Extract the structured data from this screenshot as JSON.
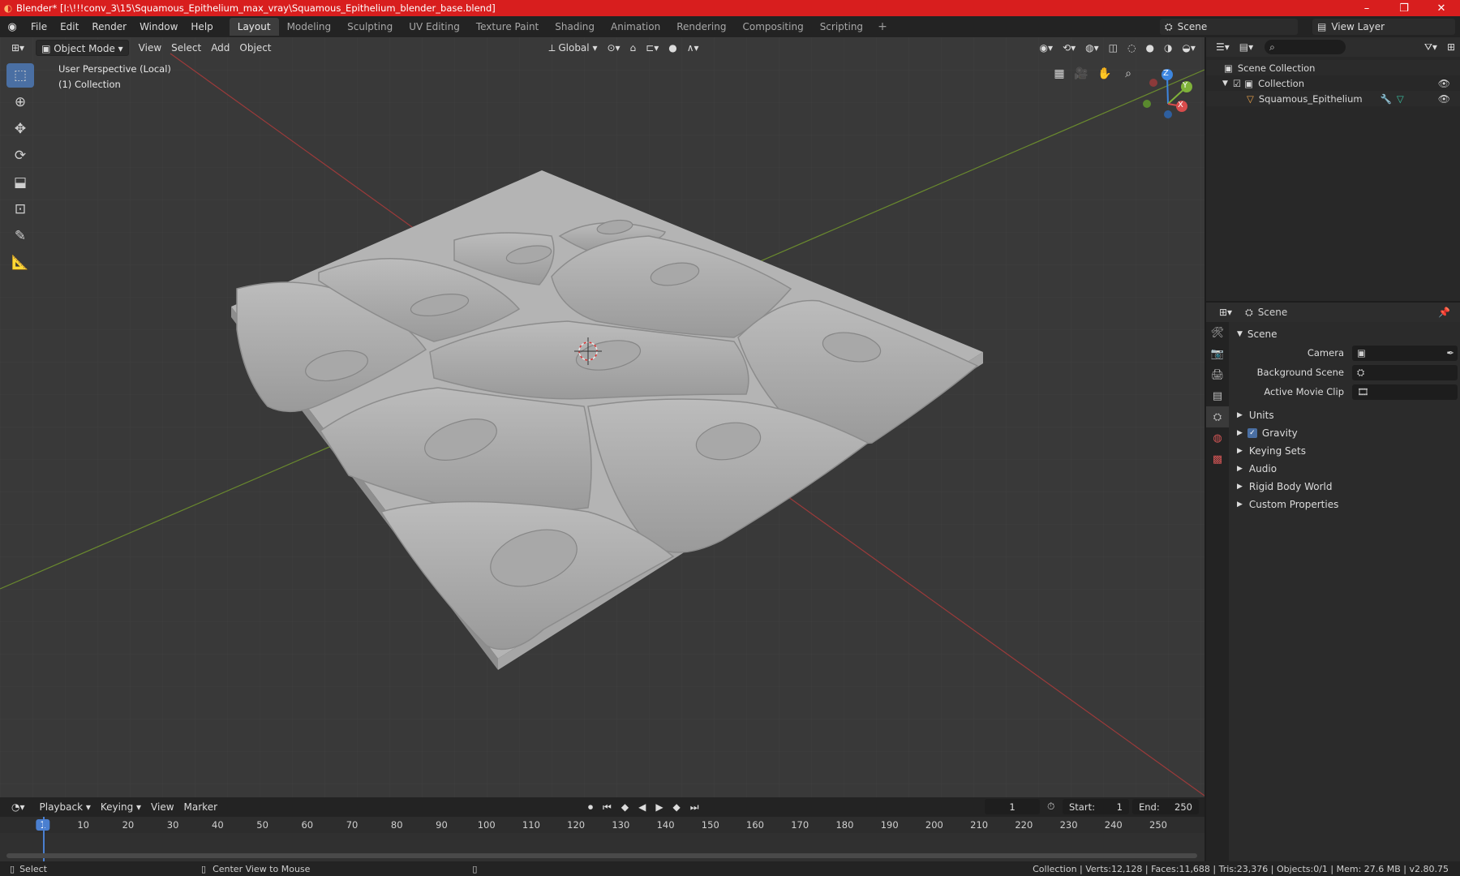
{
  "window": {
    "title": "Blender* [I:\\!!!conv_3\\15\\Squamous_Epithelium_max_vray\\Squamous_Epithelium_blender_base.blend]",
    "controls": [
      "–",
      "❐",
      "✕"
    ]
  },
  "menu": [
    "File",
    "Edit",
    "Render",
    "Window",
    "Help"
  ],
  "workspaces": [
    "Layout",
    "Modeling",
    "Sculpting",
    "UV Editing",
    "Texture Paint",
    "Shading",
    "Animation",
    "Rendering",
    "Compositing",
    "Scripting"
  ],
  "active_workspace": "Layout",
  "scene_selector": "Scene",
  "view_layer": "View Layer",
  "viewport": {
    "mode": "Object Mode",
    "menus": [
      "View",
      "Select",
      "Add",
      "Object"
    ],
    "transform_orientation": "Global",
    "perspective_label": "User Perspective (Local)",
    "collection_label": "(1) Collection",
    "gizmo_axes": [
      "Z",
      "Y",
      "X"
    ]
  },
  "tools": [
    "select-box",
    "cursor",
    "move",
    "rotate",
    "scale",
    "transform",
    "annotate",
    "measure"
  ],
  "outliner": {
    "root": "Scene Collection",
    "collection": "Collection",
    "object": "Squamous_Epithelium"
  },
  "properties": {
    "context": "Scene",
    "section": "Scene",
    "fields": [
      {
        "label": "Camera",
        "value": ""
      },
      {
        "label": "Background Scene",
        "value": ""
      },
      {
        "label": "Active Movie Clip",
        "value": ""
      }
    ],
    "panels": [
      "Units",
      "Gravity",
      "Keying Sets",
      "Audio",
      "Rigid Body World",
      "Custom Properties"
    ],
    "gravity_checked": true
  },
  "timeline": {
    "menus": [
      "Playback",
      "Keying",
      "View",
      "Marker"
    ],
    "current_frame": "1",
    "start_label": "Start:",
    "start": "1",
    "end_label": "End:",
    "end": "250",
    "ticks": [
      "1",
      "10",
      "20",
      "30",
      "40",
      "50",
      "60",
      "70",
      "80",
      "90",
      "100",
      "110",
      "120",
      "130",
      "140",
      "150",
      "160",
      "170",
      "180",
      "190",
      "200",
      "210",
      "220",
      "230",
      "240",
      "250"
    ]
  },
  "status": {
    "select": "Select",
    "center": "Center View to Mouse",
    "info": "Collection | Verts:12,128 | Faces:11,688 | Tris:23,376 | Objects:0/1 | Mem: 27.6 MB | v2.80.75"
  },
  "colors": {
    "titlebar": "#d81e1e",
    "accent": "#4a6fa3",
    "axis_x": "#d94c4c",
    "axis_y": "#7fb23a",
    "axis_z": "#3d86e0"
  }
}
